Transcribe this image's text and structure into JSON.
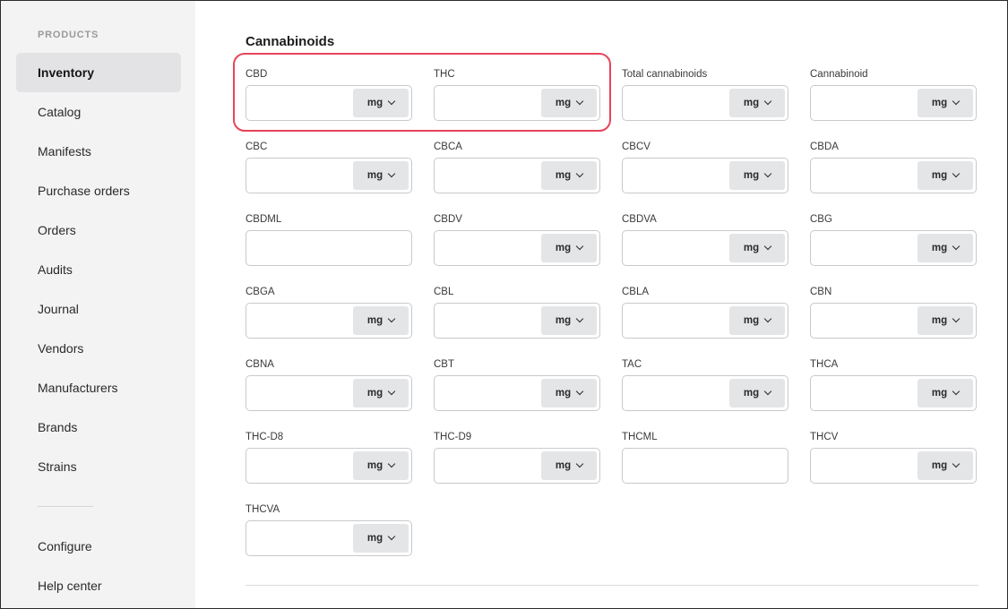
{
  "sidebar": {
    "section_label": "PRODUCTS",
    "items": [
      {
        "label": "Inventory",
        "active": true
      },
      {
        "label": "Catalog"
      },
      {
        "label": "Manifests"
      },
      {
        "label": "Purchase orders"
      },
      {
        "label": "Orders"
      },
      {
        "label": "Audits"
      },
      {
        "label": "Journal"
      },
      {
        "label": "Vendors"
      },
      {
        "label": "Manufacturers"
      },
      {
        "label": "Brands"
      },
      {
        "label": "Strains"
      }
    ],
    "footer_items": [
      {
        "label": "Configure"
      },
      {
        "label": "Help center"
      }
    ]
  },
  "main": {
    "section_title": "Cannabinoids",
    "unit_default": "mg",
    "highlight_color": "#e8445a",
    "fields": [
      {
        "label": "CBD",
        "unit": "mg",
        "value": ""
      },
      {
        "label": "THC",
        "unit": "mg",
        "value": ""
      },
      {
        "label": "Total cannabinoids",
        "unit": "mg",
        "value": ""
      },
      {
        "label": "Cannabinoid",
        "unit": "mg",
        "value": ""
      },
      {
        "label": "CBC",
        "unit": "mg",
        "value": ""
      },
      {
        "label": "CBCA",
        "unit": "mg",
        "value": ""
      },
      {
        "label": "CBCV",
        "unit": "mg",
        "value": ""
      },
      {
        "label": "CBDA",
        "unit": "mg",
        "value": ""
      },
      {
        "label": "CBDML",
        "unit": "",
        "value": ""
      },
      {
        "label": "CBDV",
        "unit": "mg",
        "value": ""
      },
      {
        "label": "CBDVA",
        "unit": "mg",
        "value": ""
      },
      {
        "label": "CBG",
        "unit": "mg",
        "value": ""
      },
      {
        "label": "CBGA",
        "unit": "mg",
        "value": ""
      },
      {
        "label": "CBL",
        "unit": "mg",
        "value": ""
      },
      {
        "label": "CBLA",
        "unit": "mg",
        "value": ""
      },
      {
        "label": "CBN",
        "unit": "mg",
        "value": ""
      },
      {
        "label": "CBNA",
        "unit": "mg",
        "value": ""
      },
      {
        "label": "CBT",
        "unit": "mg",
        "value": ""
      },
      {
        "label": "TAC",
        "unit": "mg",
        "value": ""
      },
      {
        "label": "THCA",
        "unit": "mg",
        "value": ""
      },
      {
        "label": "THC-D8",
        "unit": "mg",
        "value": ""
      },
      {
        "label": "THC-D9",
        "unit": "mg",
        "value": ""
      },
      {
        "label": "THCML",
        "unit": "",
        "value": ""
      },
      {
        "label": "THCV",
        "unit": "mg",
        "value": ""
      },
      {
        "label": "THCVA",
        "unit": "mg",
        "value": ""
      }
    ]
  }
}
